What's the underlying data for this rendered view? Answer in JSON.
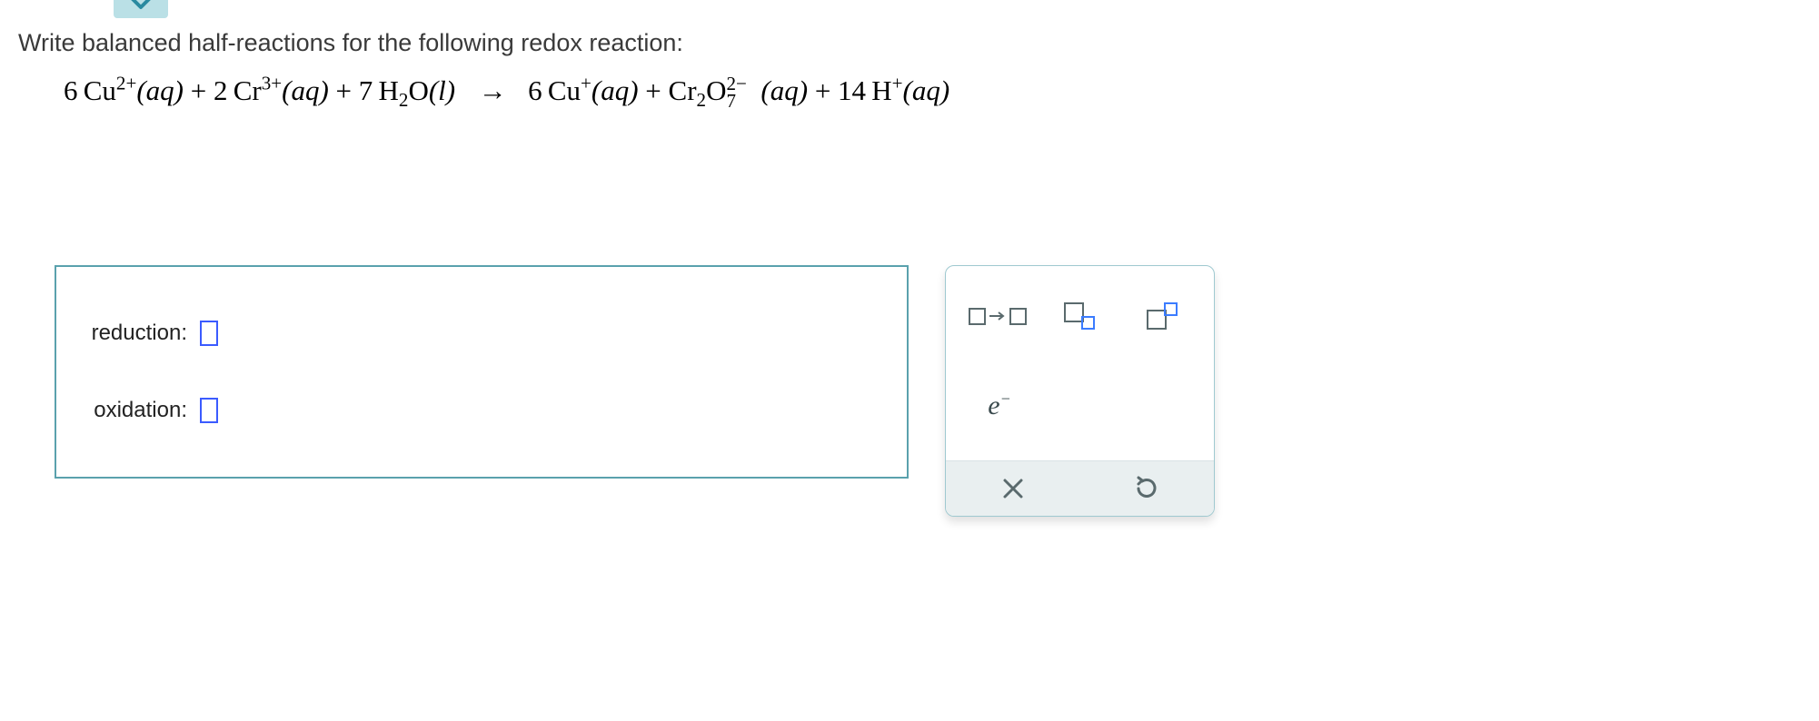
{
  "prompt": "Write balanced half-reactions for the following redox reaction:",
  "equation": {
    "reactants": [
      {
        "coef": "6",
        "symbol": "Cu",
        "sup": "2+",
        "state": "(aq)"
      },
      {
        "coef": "2",
        "symbol": "Cr",
        "sup": "3+",
        "state": "(aq)"
      },
      {
        "coef": "7",
        "symbol": "H",
        "sub": "2",
        "O": "O",
        "state": "(l)"
      }
    ],
    "products": [
      {
        "coef": "6",
        "symbol": "Cu",
        "sup": "+",
        "state": "(aq)"
      },
      {
        "symbol": "Cr",
        "sub": "2",
        "O": "O",
        "osub": "7",
        "osup": "2−",
        "state": "(aq)"
      },
      {
        "coef": "14",
        "symbol": "H",
        "sup": "+",
        "state": "(aq)"
      }
    ],
    "arrow": "→"
  },
  "answers": {
    "reduction_label": "reduction:",
    "oxidation_label": "oxidation:"
  },
  "toolbox": {
    "arrow_tool": "□→□",
    "subscript_tool": "□□",
    "superscript_tool": "□□",
    "electron_tool": "e",
    "electron_sup": "−",
    "clear_label": "clear",
    "reset_label": "reset"
  }
}
